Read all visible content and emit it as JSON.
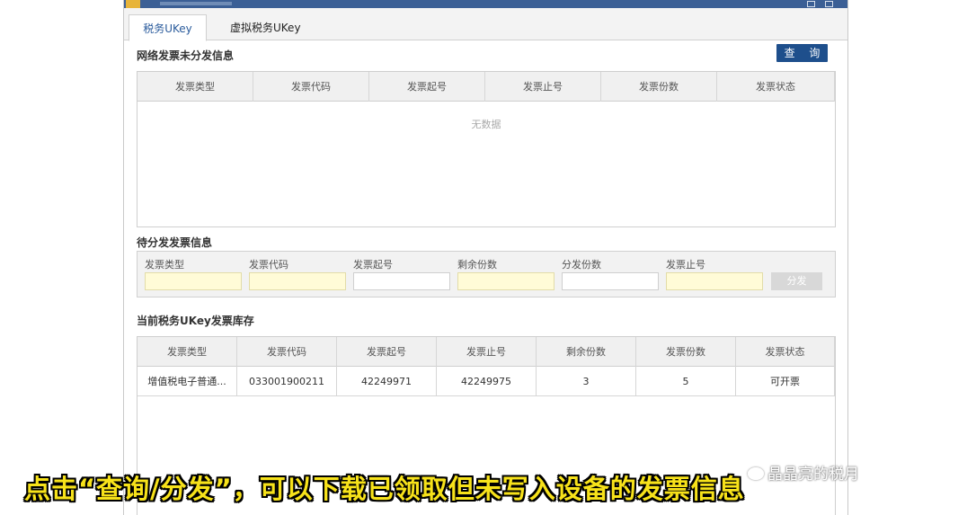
{
  "tabs": [
    {
      "label": "税务UKey",
      "active": true
    },
    {
      "label": "虚拟税务UKey",
      "active": false
    }
  ],
  "network_section": {
    "title": "网络发票未分发信息",
    "query_button": "查 询",
    "columns": [
      "发票类型",
      "发票代码",
      "发票起号",
      "发票止号",
      "发票份数",
      "发票状态"
    ],
    "empty_text": "无数据"
  },
  "pending_section": {
    "title": "待分发发票信息",
    "fields": [
      {
        "label": "发票类型",
        "value": "",
        "readonly": true
      },
      {
        "label": "发票代码",
        "value": "",
        "readonly": true
      },
      {
        "label": "发票起号",
        "value": "",
        "readonly": false
      },
      {
        "label": "剩余份数",
        "value": "",
        "readonly": true
      },
      {
        "label": "分发份数",
        "value": "",
        "readonly": false
      },
      {
        "label": "发票止号",
        "value": "",
        "readonly": true
      }
    ],
    "distribute_button": "分发"
  },
  "inventory_section": {
    "title": "当前税务UKey发票库存",
    "columns": [
      "发票类型",
      "发票代码",
      "发票起号",
      "发票止号",
      "剩余份数",
      "发票份数",
      "发票状态"
    ],
    "rows": [
      [
        "增值税电子普通...",
        "033001900211",
        "42249971",
        "42249975",
        "3",
        "5",
        "可开票"
      ]
    ]
  },
  "caption": "点击“查询/分发”，可以下载已领取但未写入设备的发票信息",
  "watermark": "晶晶亮的税月",
  "colors": {
    "titlebar": "#3b5f95",
    "query_button": "#1e4f8c",
    "readonly_field": "#fffbd7",
    "caption_text": "#f7e21a"
  }
}
